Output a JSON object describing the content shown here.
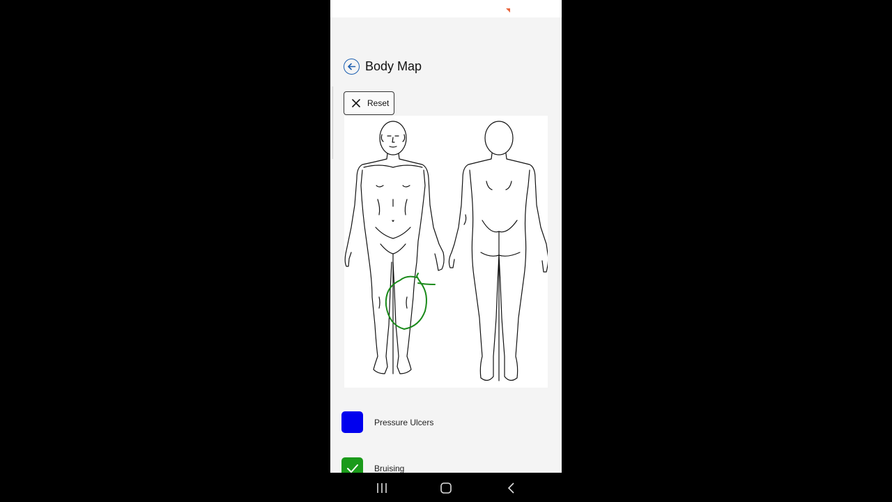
{
  "screen": {
    "title": "Body Map",
    "reset_label": "Reset"
  },
  "legend": [
    {
      "label": "Pressure Ulcers",
      "color": "#0000ee",
      "checked": false
    },
    {
      "label": "Bruising",
      "color": "#1a9a1a",
      "checked": true
    }
  ],
  "annotation": {
    "color": "#1a8a1a"
  },
  "colors": {
    "accent": "#1c5fb0",
    "top_marker": "#e8643c"
  }
}
